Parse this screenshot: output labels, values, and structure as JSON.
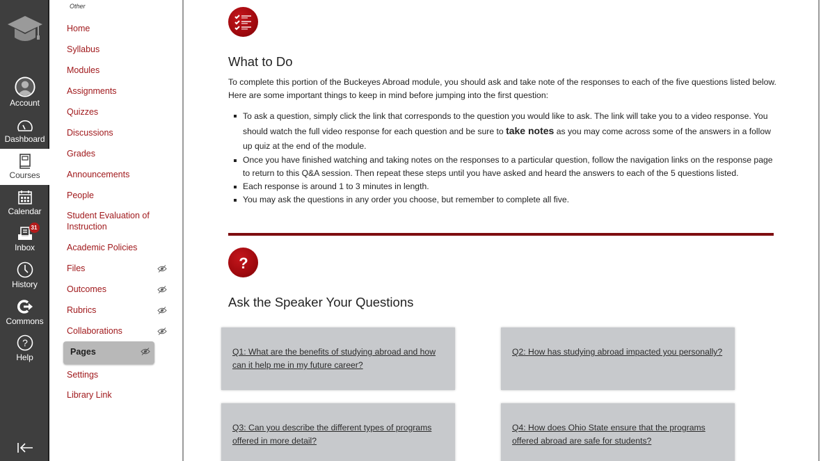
{
  "global_nav": {
    "items": [
      {
        "label": "Account",
        "icon": "account-icon"
      },
      {
        "label": "Dashboard",
        "icon": "dashboard-icon"
      },
      {
        "label": "Courses",
        "icon": "courses-icon",
        "active": true
      },
      {
        "label": "Calendar",
        "icon": "calendar-icon"
      },
      {
        "label": "Inbox",
        "icon": "inbox-icon",
        "badge": "31"
      },
      {
        "label": "History",
        "icon": "history-icon"
      },
      {
        "label": "Commons",
        "icon": "commons-icon"
      },
      {
        "label": "Help",
        "icon": "help-icon"
      }
    ],
    "collapse_icon": "collapse-nav-icon"
  },
  "course_nav": {
    "heading": "Other",
    "items": [
      {
        "label": "Home"
      },
      {
        "label": "Syllabus"
      },
      {
        "label": "Modules"
      },
      {
        "label": "Assignments"
      },
      {
        "label": "Quizzes"
      },
      {
        "label": "Discussions"
      },
      {
        "label": "Grades"
      },
      {
        "label": "Announcements"
      },
      {
        "label": "People"
      },
      {
        "label": "Student Evaluation of Instruction"
      },
      {
        "label": "Academic Policies"
      },
      {
        "label": "Files",
        "hidden_from_students": true
      },
      {
        "label": "Outcomes",
        "hidden_from_students": true
      },
      {
        "label": "Rubrics",
        "hidden_from_students": true
      },
      {
        "label": "Collaborations",
        "hidden_from_students": true
      },
      {
        "label": "Pages",
        "hidden_from_students": true,
        "active": true
      },
      {
        "label": "Settings"
      },
      {
        "label": "Library Link"
      }
    ]
  },
  "content": {
    "section1": {
      "icon": "checklist-icon",
      "title": "What to Do",
      "intro": "To complete this portion of the Buckeyes Abroad module, you should ask and take note of the responses to each of the five questions listed below. Here are some important things to keep in mind before jumping into the first question:",
      "bullets": [
        {
          "line1": "To ask a question, simply click the link that corresponds to the question you would like to ask. The link will take you to a video response.",
          "pre": "You should watch the full video response for each question and be sure to ",
          "bold": "take notes",
          "post": " as you may come across some of the answers in a follow up quiz at the end of the module."
        },
        {
          "text": "Once you have finished watching and taking notes on the responses to a particular question, follow the navigation links on the response page to return to this Q&A session. Then repeat these steps until you have asked and heard the answers to each of the 5 questions listed."
        },
        {
          "text": "Each response is around 1 to 3 minutes in length."
        },
        {
          "text": "You may ask the questions in any order you choose, but remember to complete all five."
        }
      ]
    },
    "section2": {
      "icon": "question-mark-icon",
      "title": "Ask the Speaker Your Questions",
      "questions": [
        {
          "label": "Q1: What are the benefits of studying abroad and how can it help me in my future career?"
        },
        {
          "label": "Q2: How has studying abroad impacted you personally?"
        },
        {
          "label": "Q3: Can you describe the different types of programs offered in more detail?"
        },
        {
          "label": "Q4: How does Ohio State ensure that the programs offered abroad are safe for students?"
        }
      ]
    }
  },
  "colors": {
    "brand_red": "#a0191c",
    "nav_bg": "#3e3e3e",
    "divider_red": "#7e0d10",
    "card_bg": "#c7c9cc"
  }
}
